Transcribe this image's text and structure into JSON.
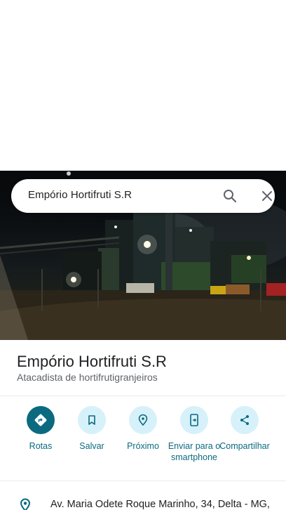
{
  "search": {
    "query": "Empório Hortifruti S.R"
  },
  "place": {
    "name": "Empório Hortifruti S.R",
    "category": "Atacadista de hortifrutigranjeiros",
    "address": "Av. Maria Odete Roque Marinho, 34, Delta - MG,"
  },
  "actions": [
    {
      "label": "Rotas",
      "icon": "directions-icon"
    },
    {
      "label": "Salvar",
      "icon": "bookmark-icon"
    },
    {
      "label": "Próximo",
      "icon": "nearby-icon"
    },
    {
      "label": "Enviar para o smartphone",
      "icon": "send-to-phone-icon"
    },
    {
      "label": "Compartilhar",
      "icon": "share-icon"
    }
  ],
  "colors": {
    "accent": "#0b6a80",
    "action_bg": "#d6f1fa"
  }
}
